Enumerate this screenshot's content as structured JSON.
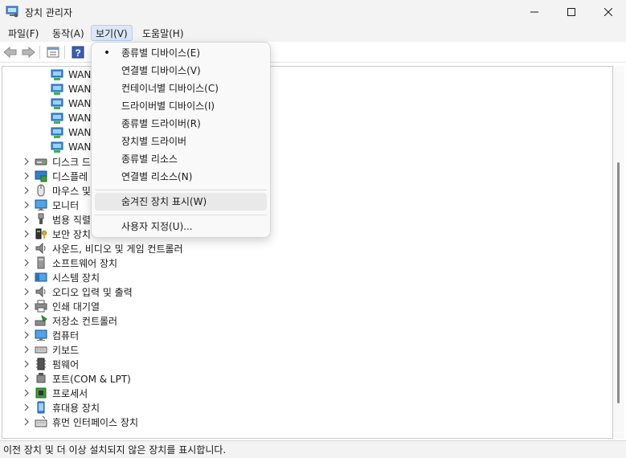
{
  "window": {
    "title": "장치 관리자"
  },
  "menu": [
    {
      "label": "파일(F)"
    },
    {
      "label": "동작(A)"
    },
    {
      "label": "보기(V)"
    },
    {
      "label": "도움말(H)"
    }
  ],
  "view_menu": {
    "items": [
      {
        "label": "종류별 디바이스(E)",
        "checked": true
      },
      {
        "label": "연결별 디바이스(V)"
      },
      {
        "label": "컨테이너별 디바이스(C)"
      },
      {
        "label": "드라이버별 디바이스(I)"
      },
      {
        "label": "종류별 드라이버(R)"
      },
      {
        "label": "장치별 드라이버"
      },
      {
        "label": "종류별 리소스"
      },
      {
        "label": "연결별 리소스(N)"
      }
    ],
    "show_hidden": "숨겨진 장치 표시(W)",
    "customize": "사용자 지정(U)...",
    "check_mark": "•"
  },
  "tree": {
    "wan_items": [
      {
        "label": "WAN"
      },
      {
        "label": "WAN"
      },
      {
        "label": "WAN"
      },
      {
        "label": "WAN"
      },
      {
        "label": "WAN"
      },
      {
        "label": "WAN"
      }
    ],
    "categories": [
      {
        "label": "디스크 드",
        "icon": "disk-icon"
      },
      {
        "label": "디스플레",
        "icon": "display-icon"
      },
      {
        "label": "마우스 및",
        "icon": "mouse-icon"
      },
      {
        "label": "모니터",
        "icon": "monitor-icon"
      },
      {
        "label": "범용 직렬",
        "icon": "usb-icon"
      },
      {
        "label": "보안 장치",
        "icon": "security-icon"
      },
      {
        "label": "사운드, 비디오 및 게임 컨트롤러",
        "icon": "speaker-icon"
      },
      {
        "label": "소프트웨어 장치",
        "icon": "software-device-icon"
      },
      {
        "label": "시스템 장치",
        "icon": "system-device-icon"
      },
      {
        "label": "오디오 입력 및 출력",
        "icon": "speaker-icon"
      },
      {
        "label": "인쇄 대기열",
        "icon": "printer-icon"
      },
      {
        "label": "저장소 컨트롤러",
        "icon": "storage-controller-icon"
      },
      {
        "label": "컴퓨터",
        "icon": "computer-icon"
      },
      {
        "label": "키보드",
        "icon": "keyboard-icon"
      },
      {
        "label": "펌웨어",
        "icon": "firmware-icon"
      },
      {
        "label": "포트(COM & LPT)",
        "icon": "port-icon"
      },
      {
        "label": "프로세서",
        "icon": "processor-icon"
      },
      {
        "label": "휴대용 장치",
        "icon": "portable-device-icon"
      },
      {
        "label": "휴먼 인터페이스 장치",
        "icon": "hid-icon"
      }
    ]
  },
  "status": {
    "text": "이전 장치 및 더 이상 설치되지 않은 장치를 표시합니다."
  },
  "colors": {
    "accent": "#0067c0",
    "menu_active": "#dbe8f7"
  }
}
